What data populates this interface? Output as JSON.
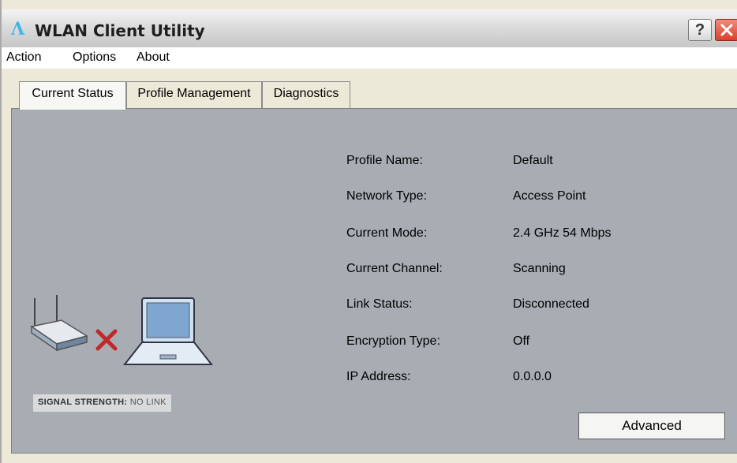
{
  "window": {
    "title": "WLAN Client Utility",
    "logo_glyph": "Λ",
    "help_label": "?"
  },
  "menu": {
    "items": [
      {
        "label": "Action"
      },
      {
        "label": "Options"
      },
      {
        "label": "About"
      }
    ]
  },
  "tabs": [
    {
      "label": "Current Status",
      "active": true
    },
    {
      "label": "Profile Management",
      "active": false
    },
    {
      "label": "Diagnostics",
      "active": false
    }
  ],
  "status": {
    "rows": [
      {
        "label": "Profile Name:",
        "value": "Default"
      },
      {
        "label": "Network Type:",
        "value": "Access Point"
      },
      {
        "label": "Current Mode:",
        "value": "2.4 GHz 54 Mbps"
      },
      {
        "label": "Current Channel:",
        "value": "Scanning"
      },
      {
        "label": "Link Status:",
        "value": "Disconnected"
      },
      {
        "label": "Encryption Type:",
        "value": "Off"
      },
      {
        "label": "IP Address:",
        "value": "0.0.0.0"
      }
    ],
    "signal_label": "SIGNAL STRENGTH:",
    "signal_value": "NO LINK",
    "advanced_label": "Advanced"
  },
  "colors": {
    "panel_bg": "#a8adb3",
    "disconnect_x": "#c0282b",
    "close_button": "#d9412b"
  },
  "icons": [
    "help-icon",
    "close-icon",
    "router-icon",
    "disconnect-x-icon",
    "laptop-icon"
  ]
}
